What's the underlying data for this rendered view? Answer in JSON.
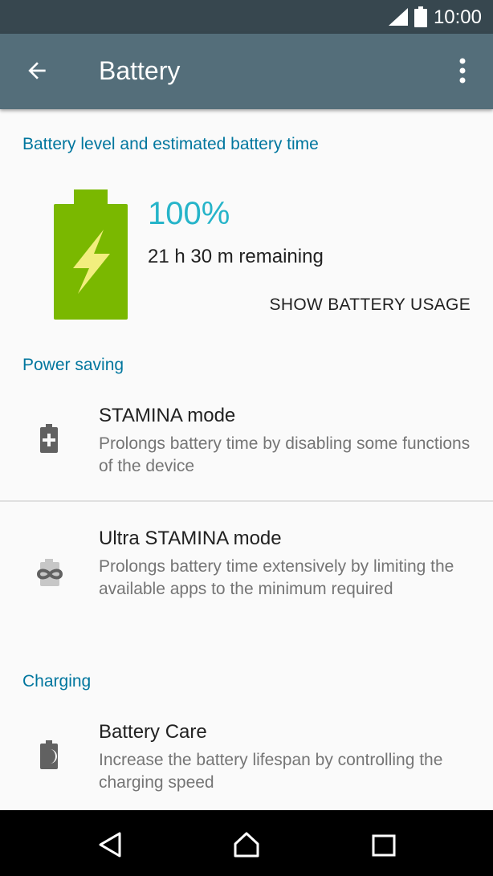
{
  "status_bar": {
    "time": "10:00",
    "icons": [
      "signal-icon",
      "battery-full-icon"
    ]
  },
  "app_bar": {
    "title": "Battery",
    "icons": [
      "back-arrow-icon",
      "overflow-menu-icon"
    ]
  },
  "battery_level": {
    "header": "Battery level and estimated battery time",
    "percent": "100%",
    "remaining": "21 h  30 m remaining",
    "show_usage_label": "SHOW BATTERY USAGE",
    "icon": "battery-charging-icon",
    "colors": {
      "battery": "#7ab800",
      "bolt": "#f2ee7e",
      "percent": "#26b4c9"
    }
  },
  "power_saving": {
    "header": "Power saving",
    "items": [
      {
        "title": "STAMINA mode",
        "summary": "Prolongs battery time by disabling some functions of the device",
        "icon": "battery-plus-icon"
      },
      {
        "title": "Ultra STAMINA mode",
        "summary": "Prolongs battery time extensively by limiting the available apps to the minimum required",
        "icon": "battery-infinity-icon"
      }
    ]
  },
  "charging": {
    "header": "Charging",
    "items": [
      {
        "title": "Battery Care",
        "summary": "Increase the battery lifespan by controlling the charging speed",
        "icon": "battery-moon-icon"
      }
    ]
  },
  "nav_bar": {
    "icons": [
      "back-nav-icon",
      "home-nav-icon",
      "recents-nav-icon"
    ]
  },
  "colors": {
    "status_bar": "#37474f",
    "app_bar": "#546e7a",
    "section_header": "#00769e",
    "background": "#fafafa"
  }
}
